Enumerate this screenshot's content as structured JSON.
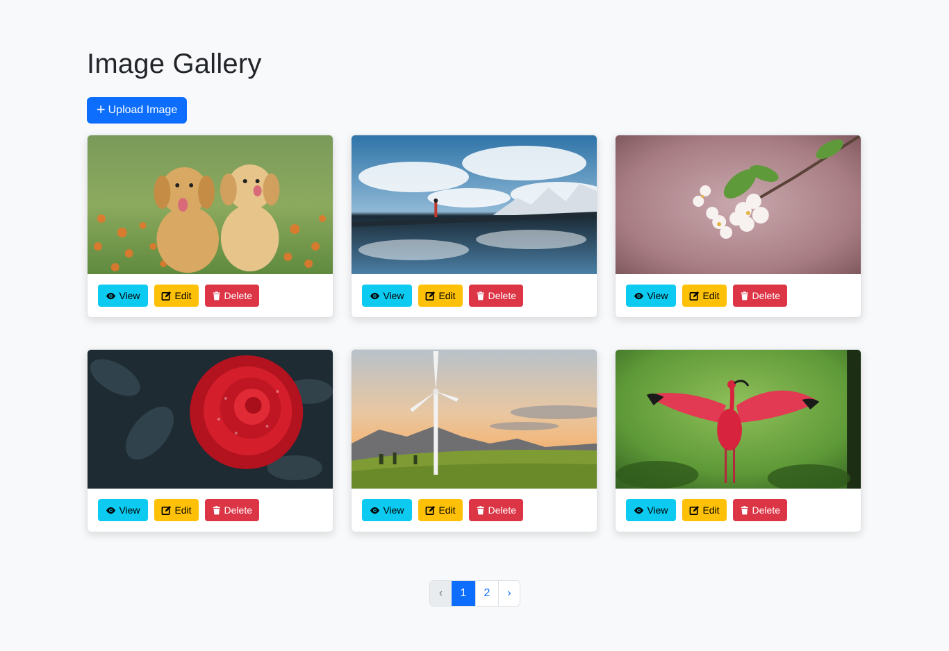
{
  "page": {
    "title": "Image Gallery"
  },
  "toolbar": {
    "upload_label": "Upload Image",
    "upload_icon": "plus-icon",
    "accent": "#0d6efd"
  },
  "actions": {
    "view_label": "View",
    "view_icon": "eye-icon",
    "view_color": "#0dcaf0",
    "edit_label": "Edit",
    "edit_icon": "edit-icon",
    "edit_color": "#ffc107",
    "delete_label": "Delete",
    "delete_icon": "trash-icon",
    "delete_color": "#dc3545"
  },
  "gallery": [
    {
      "subject": "puppies"
    },
    {
      "subject": "lake-mountains"
    },
    {
      "subject": "cherry-blossom"
    },
    {
      "subject": "red-rose"
    },
    {
      "subject": "wind-turbine"
    },
    {
      "subject": "scarlet-ibis"
    }
  ],
  "pagination": {
    "prev": "‹",
    "pages": [
      "1",
      "2"
    ],
    "next": "›",
    "current": "1"
  }
}
